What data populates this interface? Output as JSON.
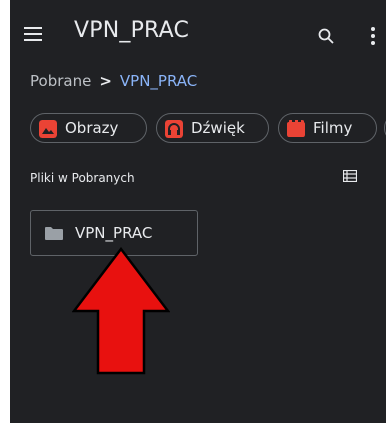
{
  "appbar": {
    "title": "VPN_PRAC",
    "menu_icon": "hamburger-menu-icon",
    "search_icon": "search-icon",
    "more_icon": "more-vert-icon"
  },
  "breadcrumb": {
    "root": "Pobrane",
    "separator": ">",
    "current": "VPN_PRAC"
  },
  "chips": [
    {
      "label": "Obrazy",
      "icon": "image-icon",
      "color": "#f28b82"
    },
    {
      "label": "Dźwięk",
      "icon": "audio-icon",
      "color": "#f28b82"
    },
    {
      "label": "Filmy",
      "icon": "video-icon",
      "color": "#f28b82"
    },
    {
      "label": "",
      "icon": "document-icon",
      "color": "#e8eaed"
    }
  ],
  "section": {
    "label": "Pliki w Pobranych",
    "view_icon": "list-view-icon"
  },
  "folders": [
    {
      "name": "VPN_PRAC",
      "icon": "folder-icon"
    }
  ],
  "colors": {
    "background": "#202124",
    "text": "#e8eaed",
    "accent": "#8ab4f8",
    "chip_icon": "#ea4335",
    "annotation_arrow": "#e8110f"
  }
}
